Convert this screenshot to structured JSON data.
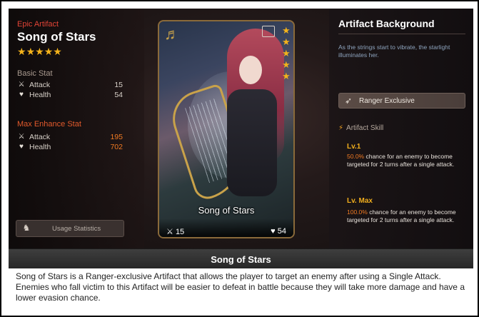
{
  "artifact": {
    "rarity": "Epic Artifact",
    "name": "Song of Stars",
    "stars": 5
  },
  "basic_stat": {
    "title": "Basic Stat",
    "attack_label": "Attack",
    "attack_value": "15",
    "health_label": "Health",
    "health_value": "54"
  },
  "max_stat": {
    "title": "Max Enhance Stat",
    "attack_label": "Attack",
    "attack_value": "195",
    "health_label": "Health",
    "health_value": "702"
  },
  "usage_button": {
    "label": "Usage Statistics",
    "icon": "person-chart-icon"
  },
  "card": {
    "name": "Song of Stars",
    "attack": "15",
    "health": "54",
    "stars": 5,
    "icons": [
      "harp-icon",
      "frame-icon"
    ]
  },
  "background": {
    "title": "Artifact Background",
    "description": "As the strings start to vibrate, the starlight illuminates her."
  },
  "exclusive": {
    "label": "Ranger Exclusive",
    "icon": "bow-icon"
  },
  "skill": {
    "title": "Artifact Skill",
    "levels": [
      {
        "label": "Lv.1",
        "percent": "50.0%",
        "text": " chance for an enemy to become targeted for 2 turns after a single attack."
      },
      {
        "label": "Lv. Max",
        "percent": "100.0%",
        "text": " chance for an enemy to become targeted for 2 turns after a single attack."
      }
    ]
  },
  "caption": {
    "title": "Song of Stars",
    "text": "Song of Stars is a Ranger-exclusive Artifact that allows the player to target an enemy after using a Single Attack. Enemies who fall victim to this Artifact will be easier to defeat in battle because they will take more damage and have a lower evasion chance."
  },
  "colors": {
    "accent_gold": "#f3b21b",
    "rarity_red": "#e24436",
    "enhance_orange": "#f07a23",
    "description_blue": "#8fa5bf"
  }
}
